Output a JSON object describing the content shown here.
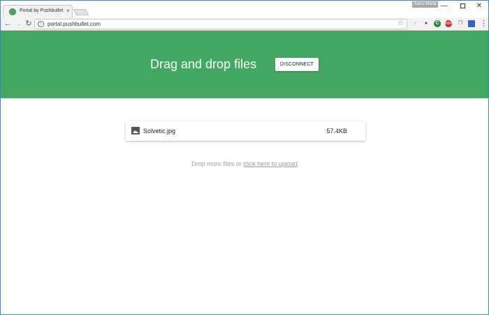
{
  "browser": {
    "tab_title": "Portal by Pushbullet",
    "tab_close": "×",
    "user_badge": "Salvo Maria",
    "url": "portal.pushbullet.com",
    "nav": {
      "back": "←",
      "forward": "→",
      "reload": "↻"
    },
    "window": {
      "minimize": "—",
      "close": "✕"
    },
    "extensions": [
      {
        "name": "pen-icon",
        "glyph": "⁄"
      },
      {
        "name": "hat-icon",
        "glyph": "♠"
      },
      {
        "name": "evernote-icon",
        "glyph": "C"
      },
      {
        "name": "adblock-icon",
        "glyph": "ABP"
      },
      {
        "name": "clone-icon",
        "glyph": "❐"
      },
      {
        "name": "screen-icon",
        "glyph": ""
      }
    ],
    "menu": "⋮"
  },
  "page": {
    "title": "Drag and drop files",
    "disconnect_label": "DISCONNECT",
    "file": {
      "name": "Solvetic.jpg",
      "size": "57.4KB"
    },
    "drop_text": "Drop more files or",
    "upload_link": "click here to upload"
  },
  "colors": {
    "hero": "#43a862",
    "window_border": "#3b86c9"
  }
}
